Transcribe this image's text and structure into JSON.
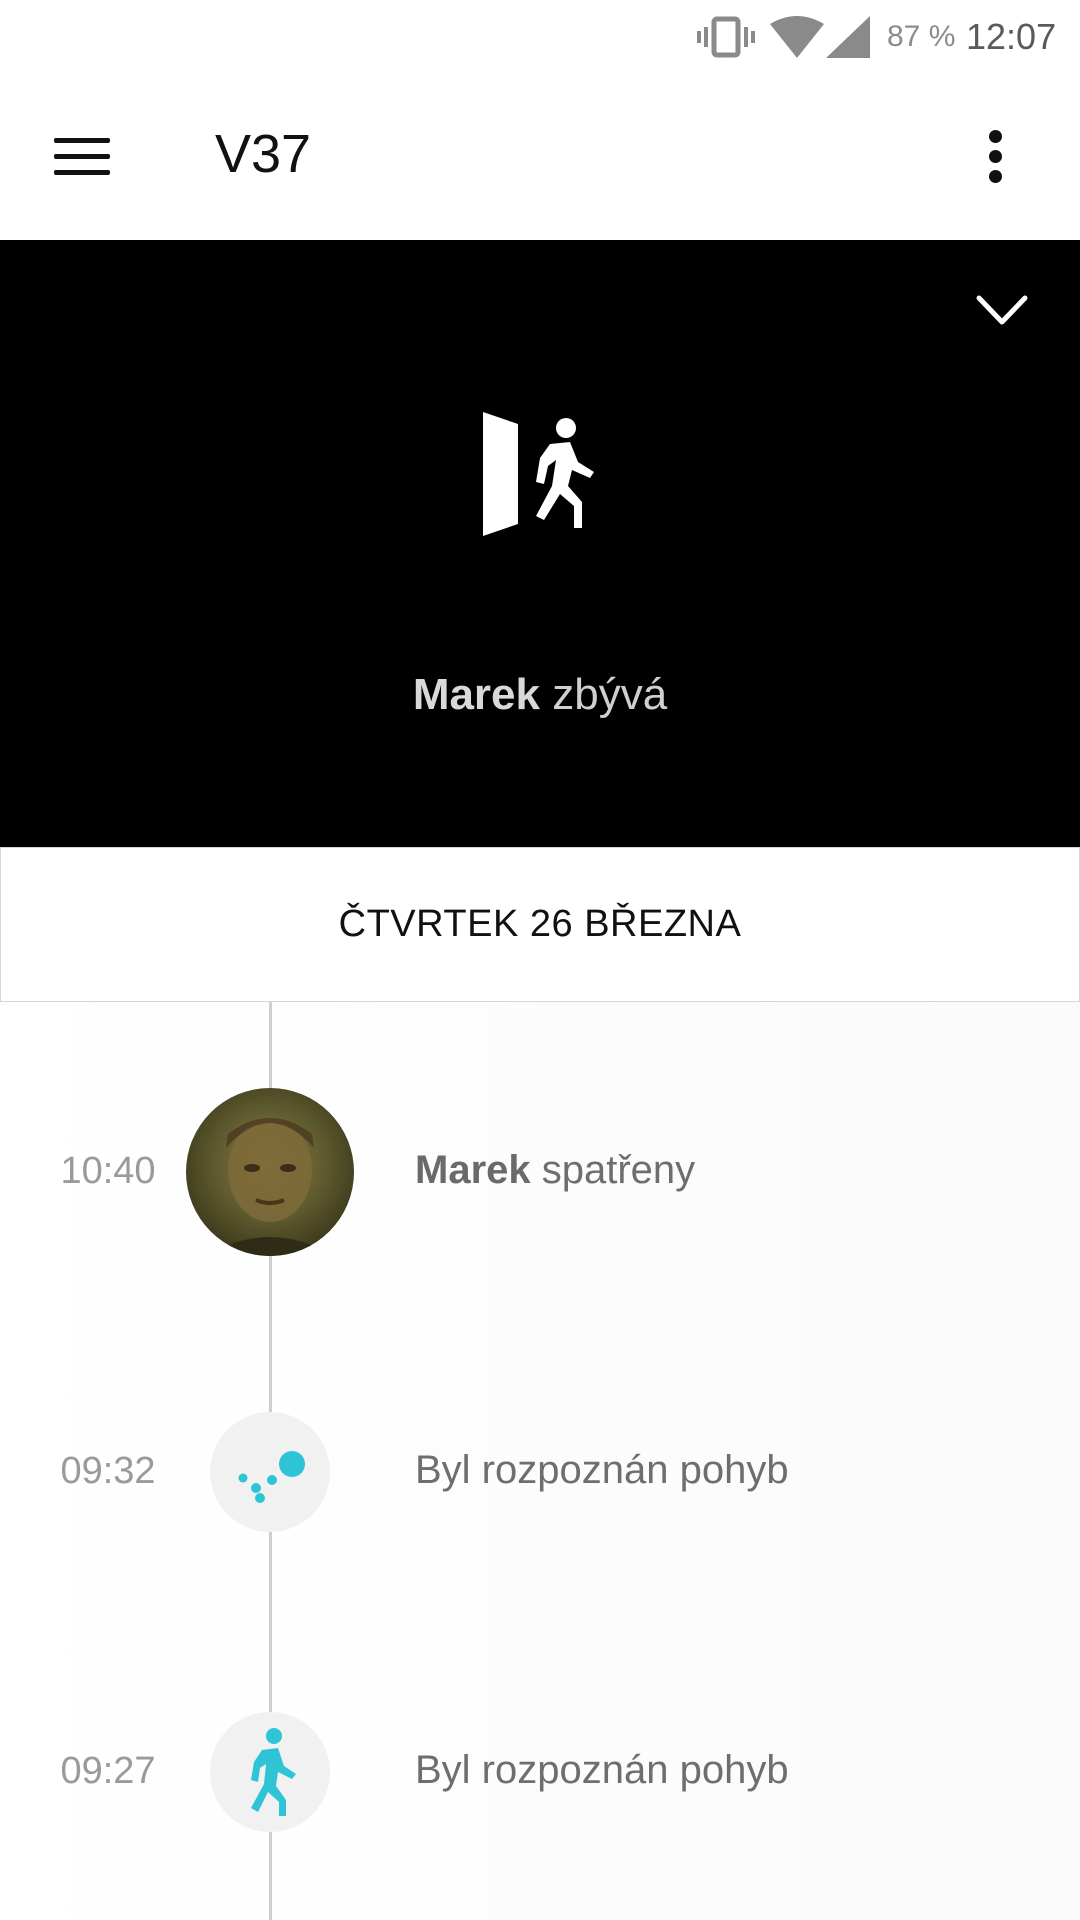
{
  "status_bar": {
    "battery": "87 %",
    "time": "12:07",
    "icons": [
      "vibrate-icon",
      "wifi-icon",
      "cell-signal-icon"
    ]
  },
  "app_bar": {
    "title": "V37",
    "icons": [
      "menu-icon",
      "more-vert-icon"
    ]
  },
  "hero": {
    "person": "Marek",
    "status": "zbývá",
    "icon": "door-exit-icon",
    "collapse_icon": "chevron-down-icon"
  },
  "date_header": "ČTVRTEK 26 BŘEZNA",
  "events": [
    {
      "time": "10:40",
      "name": "Marek",
      "text": "spatřeny",
      "icon": "avatar"
    },
    {
      "time": "09:32",
      "text": "Byl rozpoznán pohyb",
      "icon": "motion-dots-icon"
    },
    {
      "time": "09:27",
      "text": "Byl rozpoznán pohyb",
      "icon": "walking-person-icon"
    }
  ],
  "colors": {
    "accent": "#2ec4d6",
    "hero_bg": "#000000",
    "timeline_line": "#cfcfcf"
  }
}
